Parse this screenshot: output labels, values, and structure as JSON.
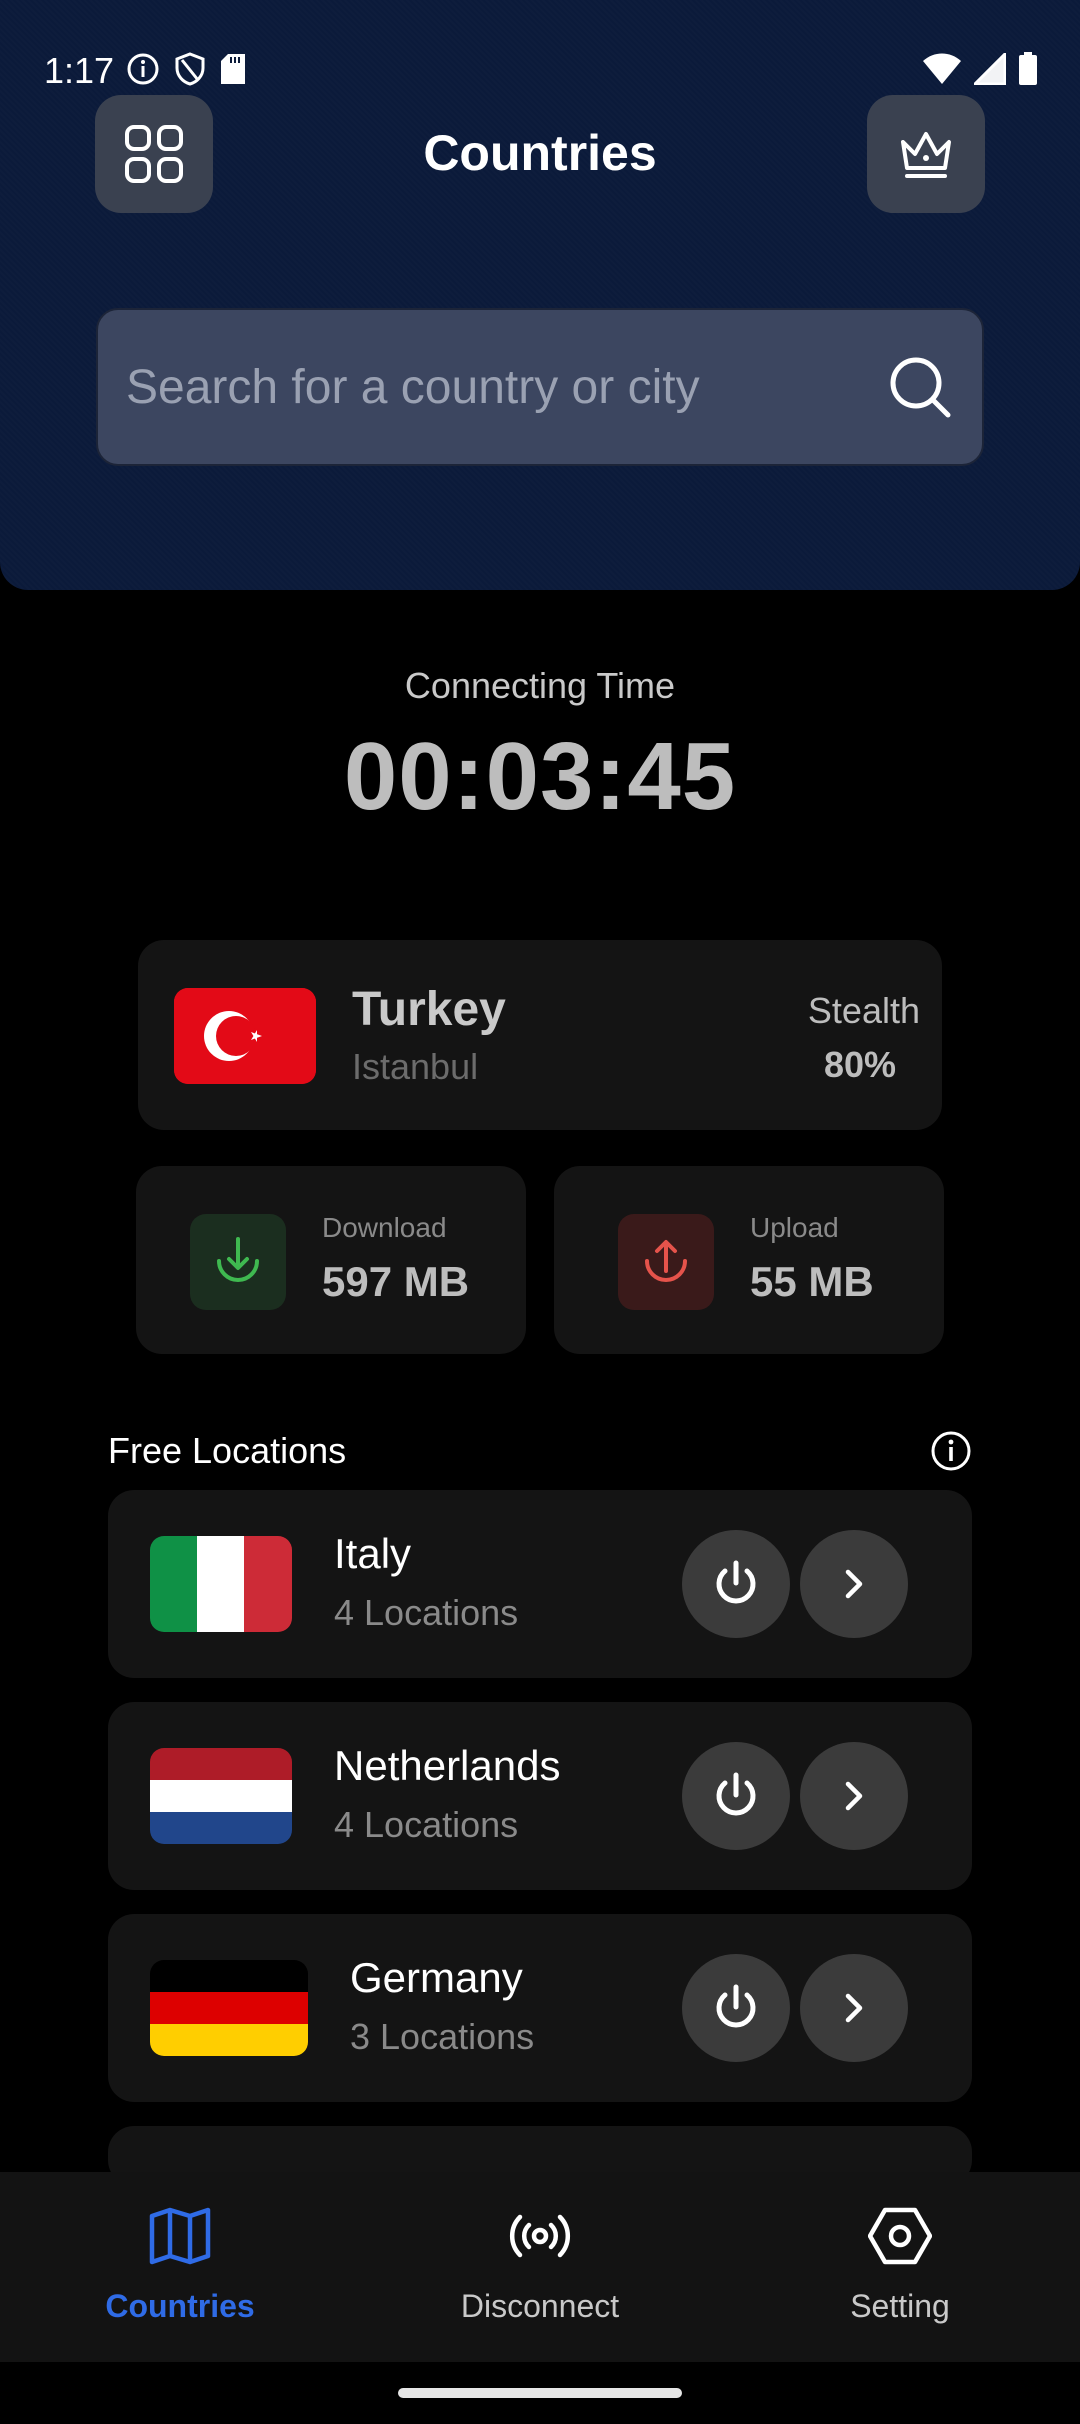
{
  "status_bar": {
    "time": "1:17",
    "left_icons": [
      "info-icon",
      "shield-icon",
      "sd-card-icon"
    ],
    "right_icons": [
      "wifi-icon",
      "signal-icon",
      "battery-icon"
    ]
  },
  "header": {
    "title": "Countries",
    "menu_icon": "grid-icon",
    "premium_icon": "crown-icon"
  },
  "search": {
    "placeholder": "Search for a country or city",
    "value": ""
  },
  "timer": {
    "label": "Connecting Time",
    "value": "00:03:45"
  },
  "server": {
    "country": "Turkey",
    "city": "Istanbul",
    "stealth_label": "Stealth",
    "stealth_value": "80%"
  },
  "stats": {
    "download_label": "Download",
    "download_value": "597 MB",
    "upload_label": "Upload",
    "upload_value": "55 MB"
  },
  "locations": {
    "title": "Free Locations",
    "items": [
      {
        "name": "Italy",
        "sub": "4 Locations"
      },
      {
        "name": "Netherlands",
        "sub": "4 Locations"
      },
      {
        "name": "Germany",
        "sub": "3 Locations"
      }
    ]
  },
  "nav": {
    "items": [
      {
        "label": "Countries",
        "icon": "map-icon",
        "active": true
      },
      {
        "label": "Disconnect",
        "icon": "broadcast-icon",
        "active": false
      },
      {
        "label": "Setting",
        "icon": "hexagon-settings-icon",
        "active": false
      }
    ]
  },
  "colors": {
    "header_bg": "#0b1a3a",
    "accent": "#2f6be6",
    "download_green": "#3fb950",
    "upload_red": "#e5534b"
  }
}
